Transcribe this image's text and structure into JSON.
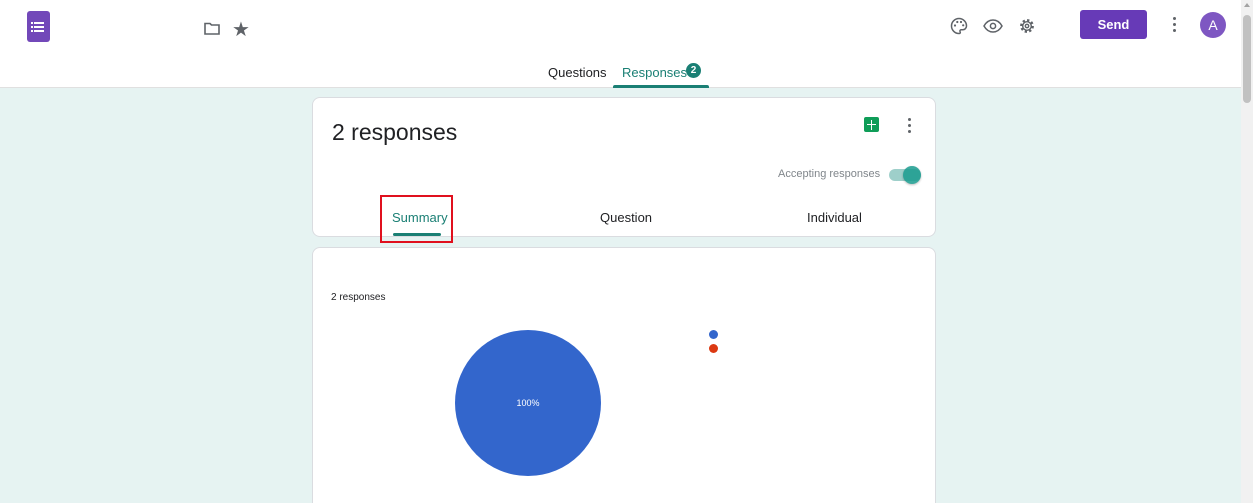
{
  "header": {
    "top_tabs": [
      {
        "label": "Questions"
      },
      {
        "label": "Responses",
        "badge": "2"
      }
    ],
    "send_label": "Send",
    "avatar_initial": "A",
    "icons": [
      "forms-logo-icon",
      "folder-icon",
      "star-icon",
      "palette-icon",
      "preview-eye-icon",
      "settings-gear-icon",
      "more-vert-icon"
    ]
  },
  "responses_card": {
    "title": "2 responses",
    "accepting_label": "Accepting responses",
    "accepting": true,
    "sub_tabs": [
      {
        "label": "Summary",
        "active": true
      },
      {
        "label": "Question",
        "active": false
      },
      {
        "label": "Individual",
        "active": false
      }
    ]
  },
  "summary_card": {
    "response_count_label": "2 responses"
  },
  "chart_data": {
    "type": "pie",
    "slices": [
      {
        "value": 100,
        "color": "#3366cc",
        "label": "100%"
      },
      {
        "value": 0,
        "color": "#dc3912"
      }
    ]
  },
  "colors": {
    "brand_purple": "#673ab7",
    "teal_accent": "#1a7f74",
    "page_background": "#e6f3f2"
  }
}
